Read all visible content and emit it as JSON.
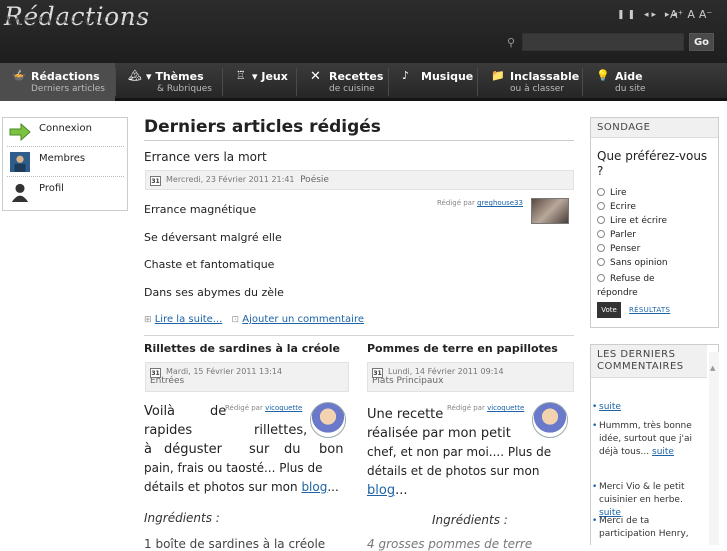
{
  "header": {
    "logo": "Rédactions",
    "audio_controls": "❚❚ ◂▸ ▸◂",
    "font_sizes": [
      "A⁺",
      "A",
      "A⁻"
    ],
    "search": {
      "placeholder": "",
      "button": "Go"
    }
  },
  "nav": [
    {
      "icon": "🍲",
      "title": "Rédactions",
      "sub": "Derniers articles",
      "active": true
    },
    {
      "icon": "🏔",
      "title": "▾ Thèmes",
      "sub": "& Rubriques"
    },
    {
      "icon": "♖",
      "title": "▾ Jeux",
      "sub": ""
    },
    {
      "icon": "✕",
      "title": "Recettes",
      "sub": "de cuisine"
    },
    {
      "icon": "♪",
      "title": "Musique",
      "sub": ""
    },
    {
      "icon": "📁",
      "title": "Inclassable",
      "sub": "ou à classer"
    },
    {
      "icon": "💡",
      "title": "Aide",
      "sub": "du site"
    }
  ],
  "left_menu": [
    {
      "label": "Connexion",
      "icon": "arrow-right-icon"
    },
    {
      "label": "Membres",
      "icon": "members-icon"
    },
    {
      "label": "Profil",
      "icon": "profile-icon"
    }
  ],
  "main": {
    "title": "Derniers articles rédigés",
    "article1": {
      "title": "Errance vers la mort",
      "date": "Mercredi, 23 Février 2011 21:41",
      "category": "Poésie",
      "byline_prefix": "Rédigé par ",
      "author": "greghouse33",
      "lines": [
        "Errance magnétique",
        "Se déversant malgré elle",
        "Chaste et fantomatique",
        "Dans ses abymes du zèle"
      ],
      "read_more": "Lire la suite...",
      "add_comment": "Ajouter un commentaire"
    },
    "article2": {
      "title": "Rillettes de sardines à la créole",
      "date": "Mardi, 15 Février 2011 13:14",
      "category": "Entrées",
      "byline_prefix": "Rédigé par ",
      "author": "vicoquette",
      "text_lines": [
        "Voilà",
        "de",
        "rapides",
        "rillettes,",
        "à",
        "déguster",
        "sur",
        "du",
        "bon",
        "pain, frais ou taosté... Plus de",
        "détails et photos sur mon "
      ],
      "blog_link": "blog",
      "ellipsis": "...",
      "ingredients": "Ingrédients :",
      "faded": "1 boîte de sardines à la créole"
    },
    "article3": {
      "title": "Pommes de terre en papillotes",
      "date": "Lundi, 14 Février 2011 09:14",
      "category": "Plats Principaux",
      "byline_prefix": "Rédigé par ",
      "author": "vicoquette",
      "text_lines": [
        "Une recette",
        "réalisée par mon petit",
        "chef, et non par moi.... Plus de",
        "détails et de photos sur mon"
      ],
      "blog_link": "blog",
      "ellipsis": "...",
      "ingredients": "Ingrédients :",
      "faded": "4 grosses pommes de terre"
    }
  },
  "poll": {
    "header": "SONDAGE",
    "question": "Que préférez-vous ?",
    "options": [
      "Lire",
      "Ecrire",
      "Lire et écrire",
      "Parler",
      "Penser",
      "Sans opinion",
      "Refuse de répondre"
    ],
    "vote": "Vote",
    "results": "RÉSULTATS"
  },
  "comments": {
    "header": "LES DERNIERS COMMENTAIRES",
    "items": [
      {
        "text": "",
        "link": "suite"
      },
      {
        "text": "Hummm, très bonne idée, surtout que j'ai déjà tous... ",
        "link": "suite"
      },
      {
        "text": "Merci Vio & le petit cuisinier en herbe. ",
        "link": "suite"
      },
      {
        "text": "Merci de ta participation Henry,",
        "link": ""
      }
    ]
  }
}
